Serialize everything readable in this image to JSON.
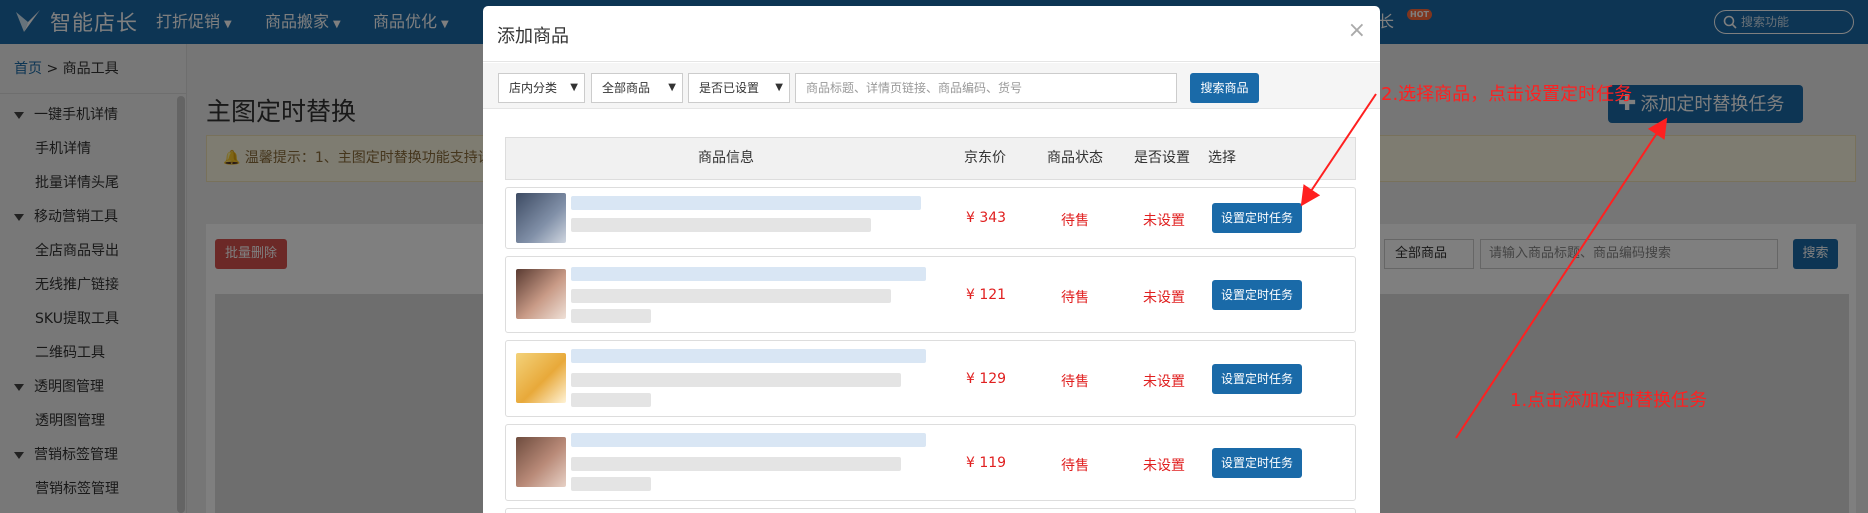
{
  "app": {
    "logo_text": "智能店长",
    "nav": [
      {
        "label": "打折促销"
      },
      {
        "label": "商品搬家"
      },
      {
        "label": "商品优化"
      }
    ],
    "nav_right_text": "长",
    "hot_badge": "HOT",
    "search_placeholder": "搜索功能"
  },
  "sidebar": {
    "breadcrumb_home": "首页",
    "breadcrumb_sep": ">",
    "breadcrumb_current": "商品工具",
    "sections": [
      {
        "label": "一键手机详情",
        "items": [
          "手机详情",
          "批量详情头尾"
        ]
      },
      {
        "label": "移动营销工具",
        "items": [
          "全店商品导出",
          "无线推广链接",
          "SKU提取工具",
          "二维码工具"
        ]
      },
      {
        "label": "透明图管理",
        "items": [
          "透明图管理"
        ]
      },
      {
        "label": "营销标签管理",
        "items": [
          "营销标签管理"
        ]
      }
    ]
  },
  "page": {
    "title": "主图定时替换",
    "alert_text": "温馨提示：1、主图定时替换功能支持设",
    "add_button": "添加定时替换任务",
    "batch_delete": "批量删除",
    "filter_select": "全部商品",
    "filter_input_placeholder": "请输入商品标题、商品编码搜索",
    "filter_search": "搜索"
  },
  "modal": {
    "title": "添加商品",
    "close": "×",
    "filters": {
      "category": "店内分类",
      "goods": "全部商品",
      "setting": "是否已设置",
      "input_placeholder": "商品标题、详情页链接、商品编码、货号",
      "search_button": "搜索商品"
    },
    "columns": [
      "商品信息",
      "京东价",
      "商品状态",
      "是否设置",
      "选择"
    ],
    "rows": [
      {
        "price": "¥ 343",
        "status": "待售",
        "is_set": "未设置",
        "action": "设置定时任务"
      },
      {
        "price": "¥ 121",
        "status": "待售",
        "is_set": "未设置",
        "action": "设置定时任务"
      },
      {
        "price": "¥ 129",
        "status": "待售",
        "is_set": "未设置",
        "action": "设置定时任务"
      },
      {
        "price": "¥ 119",
        "status": "待售",
        "is_set": "未设置",
        "action": "设置定时任务"
      }
    ]
  },
  "annotations": {
    "step1": "1.点击添加定时替换任务",
    "step2": "2.选择商品，点击设置定时任务"
  },
  "colors": {
    "nav_blue": "#1a6aa8",
    "price_red": "#e02020",
    "annotation_red": "#ff2020",
    "danger": "#d9534f"
  }
}
